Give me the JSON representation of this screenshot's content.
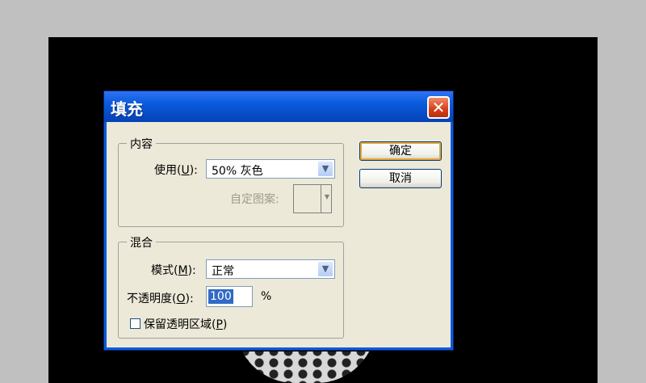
{
  "dialog": {
    "title": "填充",
    "close_glyph": "✕"
  },
  "contents_group": {
    "legend": "内容",
    "use_label_pre": "使用(",
    "use_label_key": "U",
    "use_label_post": "):",
    "use_value": "50% 灰色",
    "custom_pattern_label": "自定图案:"
  },
  "blending_group": {
    "legend": "混合",
    "mode_label_pre": "模式(",
    "mode_label_key": "M",
    "mode_label_post": "):",
    "mode_value": "正常",
    "opacity_label_pre": "不透明度(",
    "opacity_label_key": "O",
    "opacity_label_post": "):",
    "opacity_value": "100",
    "opacity_unit": "%",
    "preserve_label_pre": "保留透明区域(",
    "preserve_label_key": "P",
    "preserve_label_post": ")",
    "preserve_checked": false
  },
  "buttons": {
    "ok": "确定",
    "cancel": "取消"
  },
  "icons": {
    "dropdown": "chevron-down-icon",
    "close": "close-icon"
  },
  "colors": {
    "titlebar": "#0a5bdc",
    "dialog_bg": "#ece9d8",
    "close_red": "#d4401a",
    "selection": "#316ac5"
  }
}
